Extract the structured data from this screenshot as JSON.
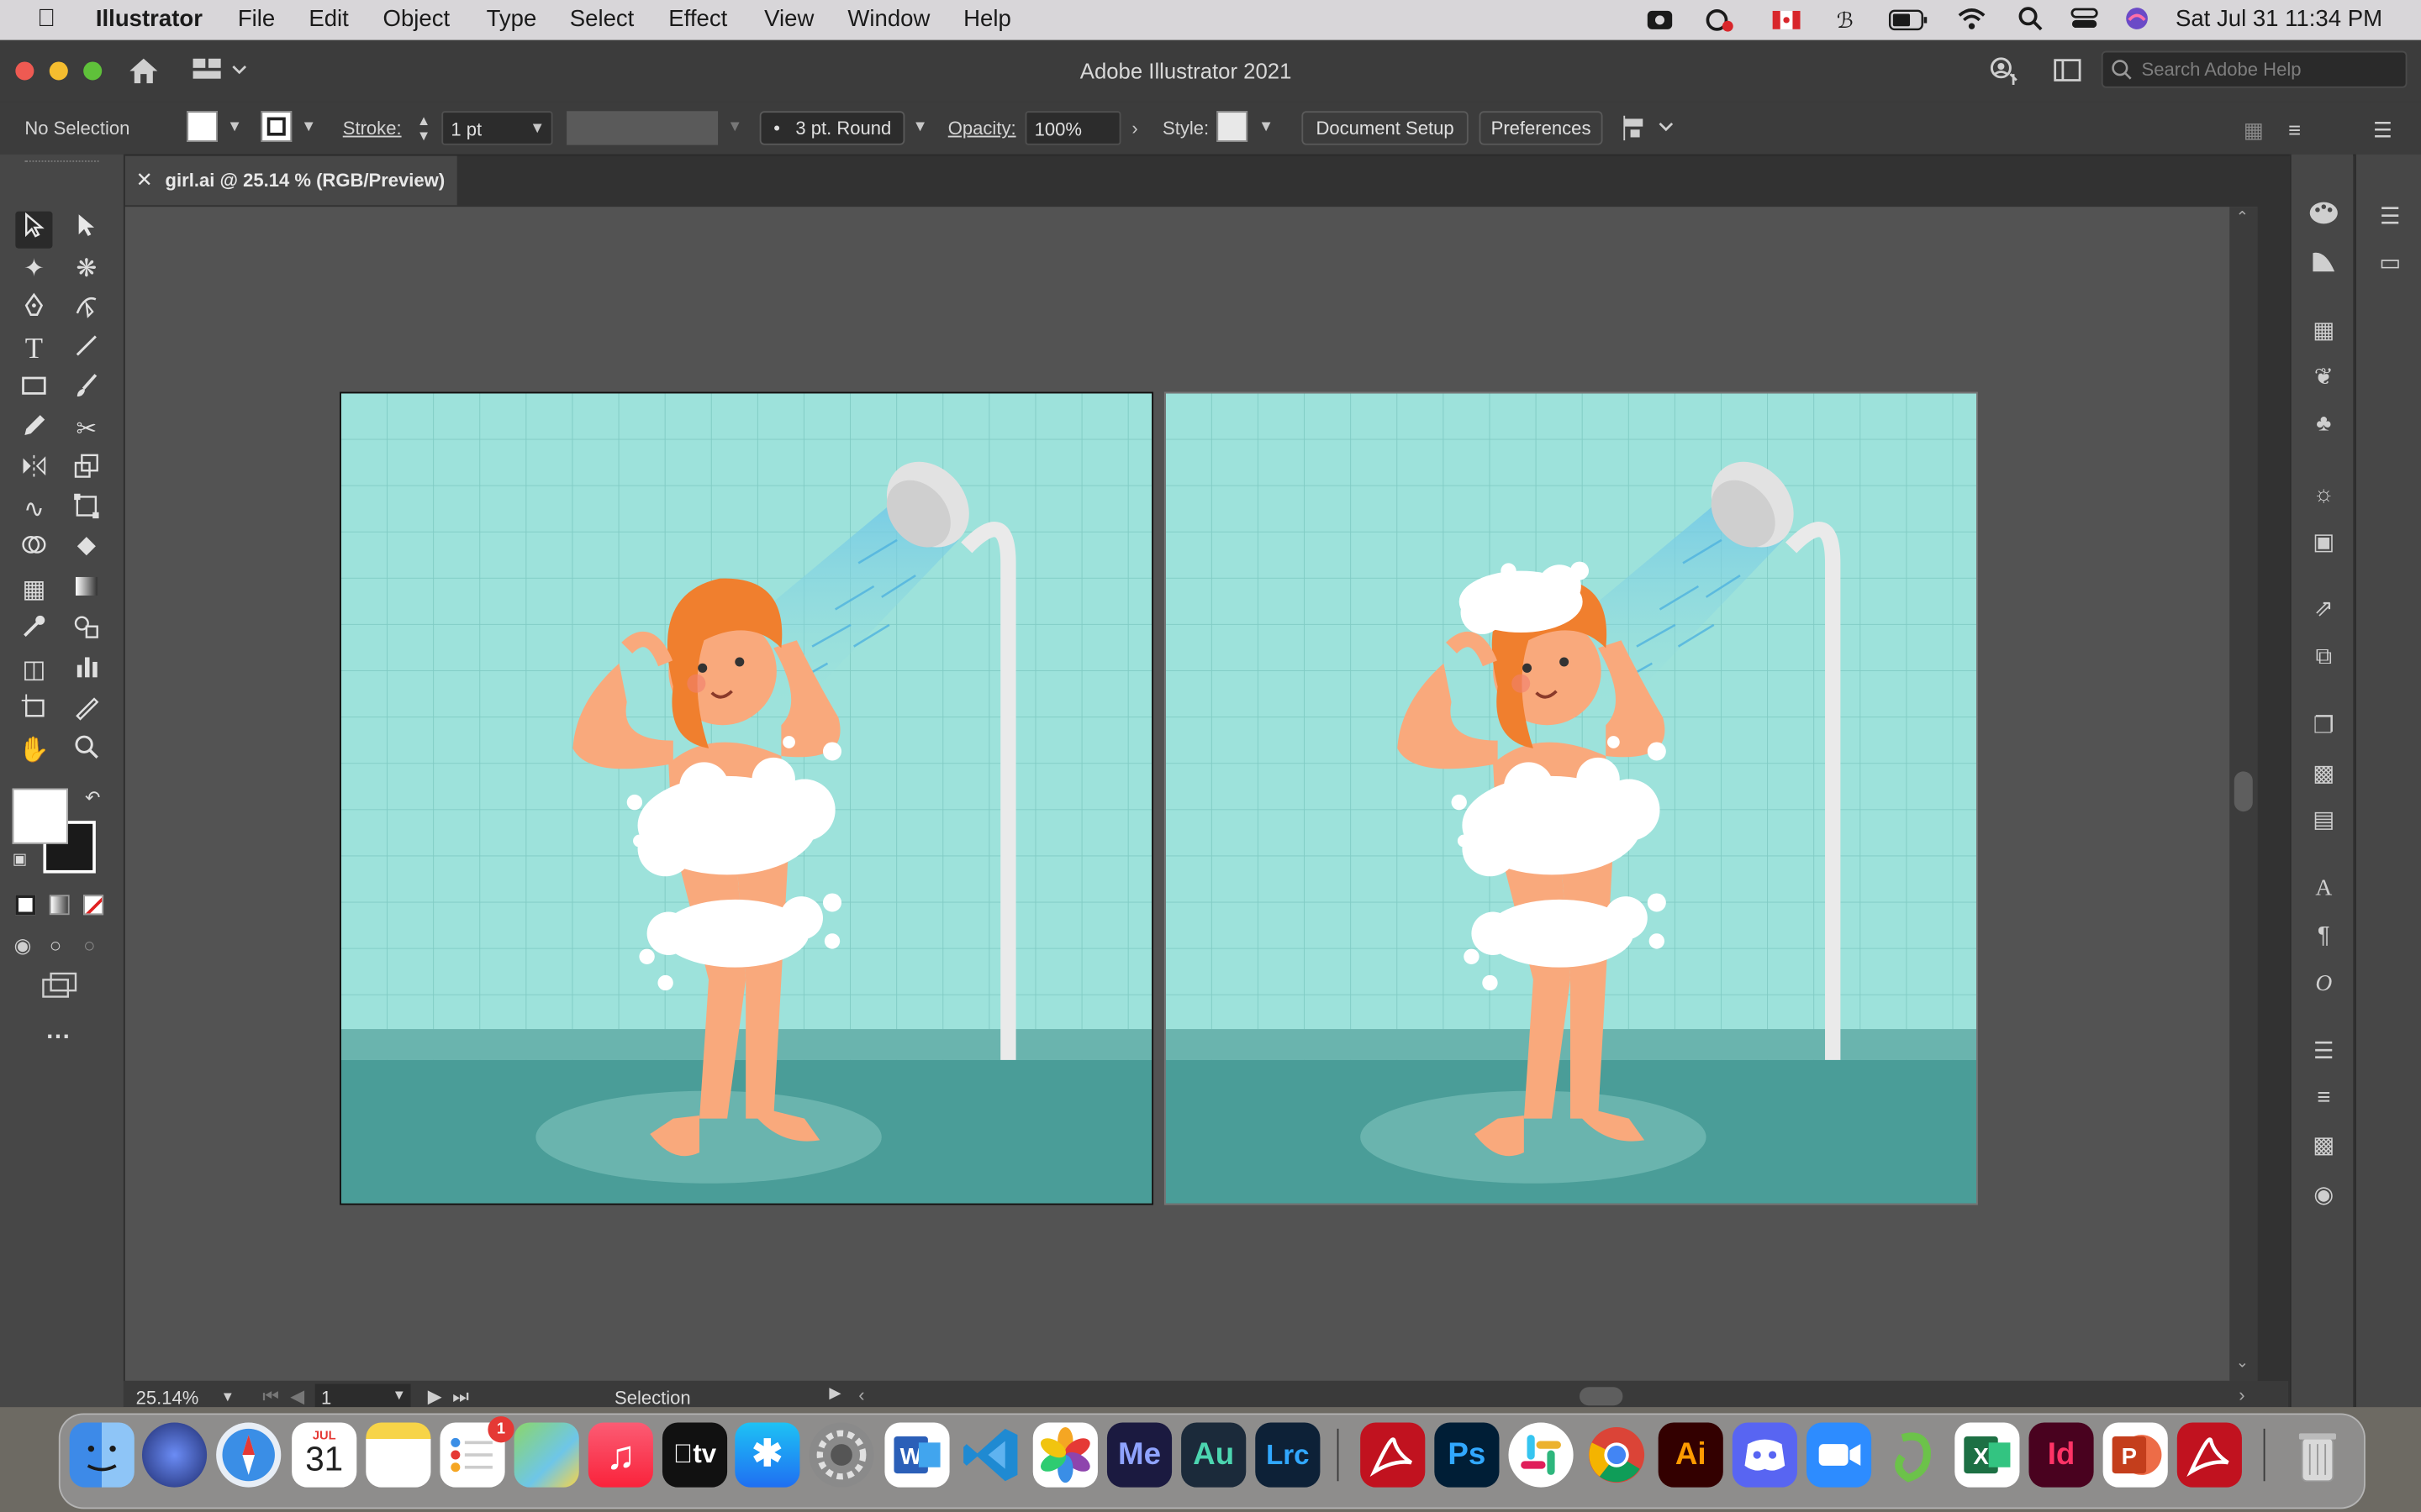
{
  "menubar": {
    "app_name": "Illustrator",
    "items": [
      "File",
      "Edit",
      "Object",
      "Type",
      "Select",
      "Effect",
      "View",
      "Window",
      "Help"
    ],
    "datetime": "Sat Jul 31  11:34 PM"
  },
  "window": {
    "title": "Adobe Illustrator 2021",
    "search_placeholder": "Search Adobe Help"
  },
  "control_bar": {
    "selection_status": "No Selection",
    "stroke_label": "Stroke:",
    "stroke_weight": "1 pt",
    "brush": "3 pt. Round",
    "opacity_label": "Opacity:",
    "opacity_value": "100%",
    "style_label": "Style:",
    "document_setup": "Document Setup",
    "preferences": "Preferences"
  },
  "document_tab": {
    "title": "girl.ai @ 25.14 % (RGB/Preview)"
  },
  "status_bar": {
    "zoom": "25.14%",
    "artboard_number": "1",
    "current_tool": "Selection"
  },
  "dock": {
    "calendar_month": "JUL",
    "calendar_day": "31",
    "reminders_badge": "1",
    "labels": {
      "tv": "tv",
      "media_encoder": "Me",
      "audition": "Au",
      "lightroom": "Lrc",
      "photoshop": "Ps",
      "illustrator": "Ai",
      "indesign": "Id"
    }
  },
  "colors": {
    "tile": "#9de2db",
    "floor": "#4a9d98",
    "floor_band": "#6ab4ae",
    "hair": "#f07f2e",
    "skin": "#f9a97c",
    "foam": "#ffffff",
    "accent_red": "#d8262b"
  }
}
